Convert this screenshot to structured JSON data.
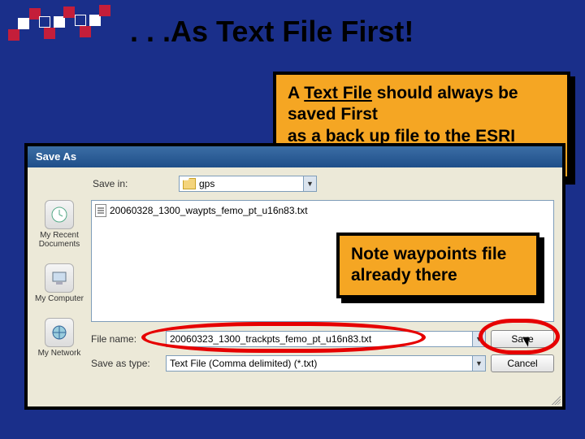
{
  "slide": {
    "title": ". . .As Text File First!"
  },
  "callout1": {
    "prefix": "A ",
    "underlined": "Text File",
    "mid": " should always be saved First\nas a back up file to the ",
    "underlined2": "ESRI Shapefile"
  },
  "callout2": {
    "text": "Note waypoints file already there"
  },
  "dialog": {
    "title": "Save As",
    "save_in_label": "Save in:",
    "save_in_value": "gps",
    "file_list": [
      "20060328_1300_waypts_femo_pt_u16n83.txt"
    ],
    "filename_label": "File name:",
    "filename_value": "20060323_1300_trackpts_femo_pt_u16n83.txt",
    "savetype_label": "Save as type:",
    "savetype_value": "Text File (Comma delimited) (*.txt)",
    "save_btn": "Save",
    "cancel_btn": "Cancel",
    "places": {
      "recent": "My Recent Documents",
      "computer": "My Computer",
      "network": "My Network"
    }
  }
}
